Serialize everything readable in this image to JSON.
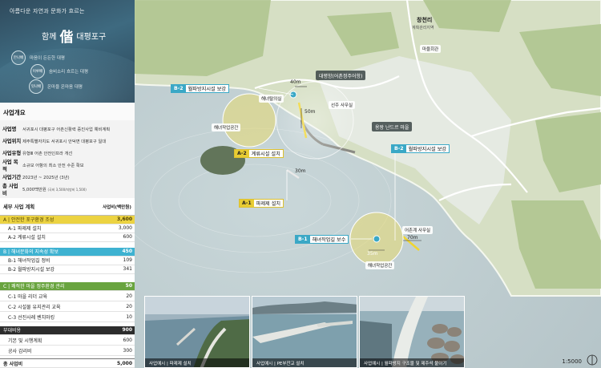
{
  "hero": {
    "subtitle": "아름다운 자연과 문화가 흐르는",
    "title_prefix": "함께",
    "title_char": "偕",
    "title_suffix": "대평포구",
    "mottos": [
      {
        "badge": "만나배",
        "text": "마음이 든든한 대평"
      },
      {
        "badge": "이루배",
        "text": "숨비소리 흐르는 대평"
      },
      {
        "badge": "잇나배",
        "text": "온마을 온마음 대평"
      }
    ]
  },
  "overview": {
    "heading": "사업개요",
    "rows": [
      {
        "key": "사업명",
        "value": "서귀포시 대평포구 어촌신활력 증진사업 예비계획"
      },
      {
        "key": "사업위치",
        "value": "제주특별자치도 서귀포시 안덕면 대평포구 일대"
      },
      {
        "key": "사업유형",
        "value": "유형Ⅲ 어촌 안전인프라 개선"
      },
      {
        "key": "사업 목적",
        "value": "소규모 어항의 최소 안전 수준 확보"
      },
      {
        "key": "사업기간",
        "value": "2023년 ~ 2025년 (3년)"
      },
      {
        "key": "총 사업비",
        "value": "5,000백만원",
        "note": "(국비 3,500/지방비 1,500)"
      }
    ]
  },
  "plan": {
    "heading": "세부 사업 계획",
    "unit": "사업비(백만원)",
    "rows": [
      {
        "type": "cat",
        "color": "yellow",
        "name": "A | 안전한 포구환경 조성",
        "amount": "3,600"
      },
      {
        "type": "sub",
        "name": "A-1 파제제 설치",
        "amount": "3,000"
      },
      {
        "type": "sub",
        "name": "A-2 계류시설 설치",
        "amount": "600"
      },
      {
        "type": "cat",
        "color": "blue",
        "name": "B | 해녀문화의 지속성 확보",
        "amount": "450"
      },
      {
        "type": "sub",
        "name": "B-1 해녀작업길 정비",
        "amount": "109"
      },
      {
        "type": "sub",
        "name": "B-2 월파방지시설 보강",
        "amount": "341"
      },
      {
        "type": "cat",
        "color": "green",
        "name": "C | 쾌적한 마을 정주환경 관리",
        "amount": "50"
      },
      {
        "type": "sub",
        "name": "C-1 마을 리더 교육",
        "amount": "20"
      },
      {
        "type": "sub",
        "name": "C-2 시설물 유지관리 교육",
        "amount": "20"
      },
      {
        "type": "sub",
        "name": "C-3 선진사례 벤치마킹",
        "amount": "10"
      },
      {
        "type": "cat",
        "color": "gray",
        "name": "부대비용",
        "amount": "900"
      },
      {
        "type": "sub",
        "name": "기본 및 시행계획",
        "amount": "600"
      },
      {
        "type": "sub",
        "name": "공사 감리비",
        "amount": "300"
      },
      {
        "type": "total",
        "name": "총 사업비",
        "amount": "5,000"
      }
    ]
  },
  "map": {
    "village": "창천리",
    "village_sub": "계획관리지역",
    "village_hall": "마을회관",
    "port": "대평항(어촌정주어항)",
    "yongwang": "용왕 난드르 마을",
    "haenyeo_shed": "해녀탈의실",
    "seonju": "선주 사무실",
    "eochon": "어촌계 사무실",
    "work_space_1": "해녀작업공간",
    "work_space_2": "해녀작업공간",
    "tags": {
      "b2a": {
        "code": "B-2",
        "text": "월파방지시설 보강"
      },
      "b2b": {
        "code": "B-2",
        "text": "월파방지시설 보강"
      },
      "a2": {
        "code": "A-2",
        "text": "계류시설 설치"
      },
      "a1": {
        "code": "A-1",
        "text": "파제제 설치"
      },
      "b1": {
        "code": "B-1",
        "text": "해녀작업길 보수"
      }
    },
    "dims": {
      "d40": "40m",
      "d50": "50m",
      "d30": "30m",
      "d35": "35m",
      "d70": "70m"
    },
    "scale": "1:5000"
  },
  "photos": [
    {
      "caption": "사업예시 | 파제제 설치"
    },
    {
      "caption": "사업예시 | PE부잔교 설치"
    },
    {
      "caption": "사업예시 | 월파방지 구조물 및 제주석 붙이기"
    }
  ],
  "colors": {
    "yellow": "#ecd342",
    "blue": "#3eb2d1",
    "green": "#69a43f",
    "dark": "#2c2c2c"
  }
}
